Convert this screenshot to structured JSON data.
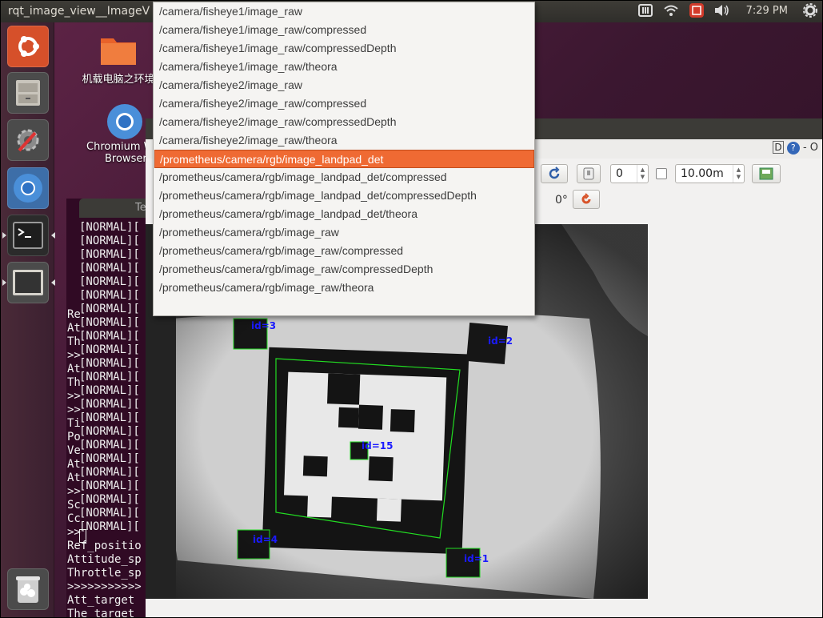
{
  "panel": {
    "window_title": "rqt_image_view__ImageV",
    "clock": "7:29 PM"
  },
  "desktop": {
    "folder_label": "机载电脑之环境",
    "chromium_label_1": "Chromium W",
    "chromium_label_2": "Browser"
  },
  "terminal": {
    "tab_label": "Te",
    "normal_lines": [
      "[NORMAL][",
      "[NORMAL][",
      "[NORMAL][",
      "[NORMAL][",
      "[NORMAL][",
      "[NORMAL][",
      "[NORMAL][",
      "[NORMAL][",
      "[NORMAL][",
      "[NORMAL][",
      "[NORMAL][",
      "[NORMAL][",
      "[NORMAL][",
      "[NORMAL][",
      "[NORMAL][",
      "[NORMAL][",
      "[NORMAL][",
      "[NORMAL][",
      "[NORMAL][",
      "[NORMAL][",
      "[NORMAL][",
      "[NORMAL][",
      "[NORMAL]["
    ],
    "left_fragments": [
      "Re",
      "At",
      "Th",
      ">>",
      "At",
      "Th",
      ">>",
      ">>",
      "Ti",
      "Po",
      "Ve",
      "At",
      "At",
      ">>",
      "Sc",
      "Cc",
      ">>"
    ],
    "bottom_lines": [
      "Ref_positio",
      "Attitude_sp",
      "Throttle_sp",
      ">>>>>>>>>>>",
      "Att_target",
      "The target"
    ]
  },
  "rqt": {
    "spin_value": "0",
    "zoom_value": "10.00m",
    "rotation": "0°",
    "help_text": "D",
    "close_text": "- O"
  },
  "dropdown": {
    "selected_index": 8,
    "items": [
      "/camera/fisheye1/image_raw",
      "/camera/fisheye1/image_raw/compressed",
      "/camera/fisheye1/image_raw/compressedDepth",
      "/camera/fisheye1/image_raw/theora",
      "/camera/fisheye2/image_raw",
      "/camera/fisheye2/image_raw/compressed",
      "/camera/fisheye2/image_raw/compressedDepth",
      "/camera/fisheye2/image_raw/theora",
      "/prometheus/camera/rgb/image_landpad_det",
      "/prometheus/camera/rgb/image_landpad_det/compressed",
      "/prometheus/camera/rgb/image_landpad_det/compressedDepth",
      "/prometheus/camera/rgb/image_landpad_det/theora",
      "/prometheus/camera/rgb/image_raw",
      "/prometheus/camera/rgb/image_raw/compressed",
      "/prometheus/camera/rgb/image_raw/compressedDepth",
      "/prometheus/camera/rgb/image_raw/theora"
    ]
  },
  "markers": {
    "m3": "id=3",
    "m2": "id=2",
    "m15": "id=15",
    "m4": "id=4",
    "m1": "id=1"
  },
  "colors": {
    "selection": "#ef6a33",
    "marker_label": "#1a1aff",
    "marker_outline": "#22dd22"
  }
}
